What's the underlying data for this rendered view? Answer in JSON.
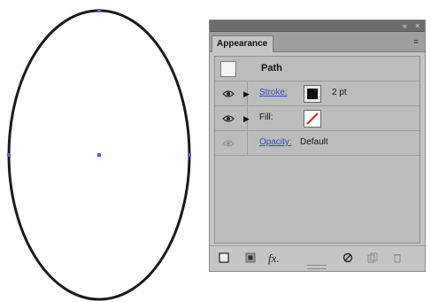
{
  "panel": {
    "tab_label": "Appearance",
    "collapse_glyph": "«",
    "close_glyph": "×",
    "menu_glyph": "≡"
  },
  "appearance": {
    "object_type": "Path",
    "stroke_label": "Stroke:",
    "stroke_weight": "2 pt",
    "fill_label": "Fill:",
    "opacity_label": "Opacity:",
    "opacity_value": "Default"
  },
  "footer": {
    "fx_label": "fx."
  },
  "icons": [
    "new-art-icon",
    "clear-appearance-icon",
    "fx-icon",
    "no-symbol-icon",
    "duplicate-icon",
    "delete-icon",
    "eye-icon",
    "expand-triangle-icon"
  ],
  "colors": {
    "selection": "#5b5fc7",
    "link": "#2d4fbf",
    "panel_bg": "#c5c5c5",
    "stroke": "#111111",
    "no_fill_slash": "#d62020"
  }
}
